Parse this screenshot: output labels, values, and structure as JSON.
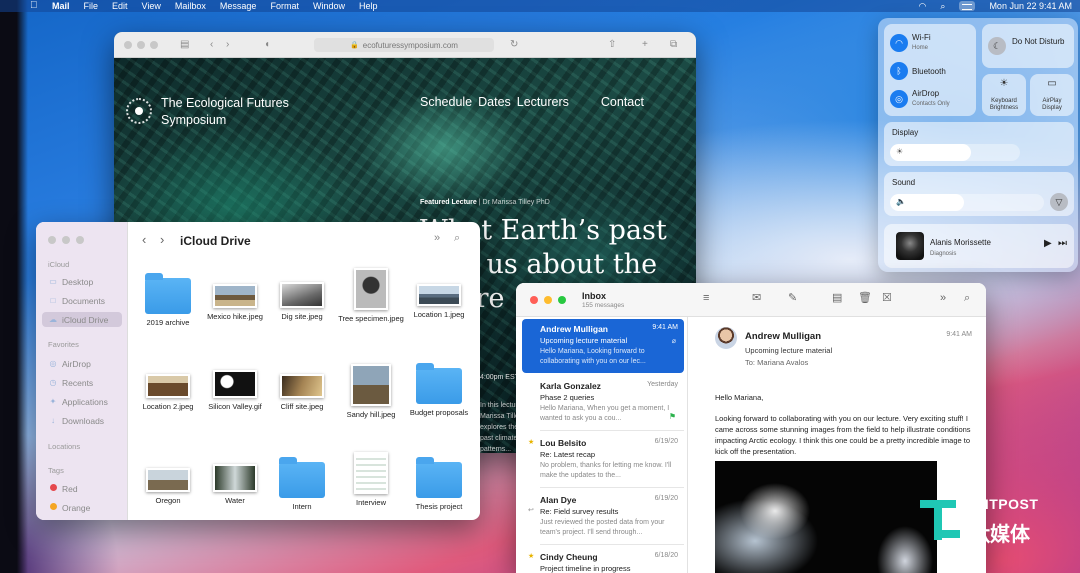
{
  "menubar": {
    "app_name": "Mail",
    "menus": [
      "File",
      "Edit",
      "View",
      "Mailbox",
      "Message",
      "Format",
      "Window",
      "Help"
    ],
    "clock": "Mon Jun 22  9:41 AM"
  },
  "safari": {
    "url": "ecofuturessymposium.com",
    "site": {
      "title": "The Ecological Futures Symposium",
      "nav": [
        "Schedule",
        "Dates",
        "Lecturers",
        "Contact"
      ],
      "featured_label": "Featured Lecture",
      "featured_speaker": "| Dr Marissa Tilley PhD",
      "headline": "What Earth’s past tells us about the future",
      "small_time": "4:00pm EST",
      "side_text": "In this lecture, Dr Marissa Tilley PhD explores the rise of past climate patterns..."
    }
  },
  "control_center": {
    "wifi": {
      "label": "Wi-Fi",
      "sub": "Home"
    },
    "bluetooth": {
      "label": "Bluetooth"
    },
    "airdrop": {
      "label": "AirDrop",
      "sub": "Contacts Only"
    },
    "dnd": {
      "label": "Do Not Disturb"
    },
    "keyboard": {
      "label": "Keyboard Brightness"
    },
    "airplay": {
      "label": "AirPlay Display"
    },
    "display": {
      "label": "Display",
      "level": 0.62
    },
    "sound": {
      "label": "Sound",
      "level": 0.48
    },
    "now_playing": {
      "artist": "Alanis Morissette",
      "track": "Diagnosis"
    }
  },
  "finder": {
    "title": "iCloud Drive",
    "sidebar": {
      "icloud_heading": "iCloud",
      "icloud_items": [
        "Desktop",
        "Documents",
        "iCloud Drive"
      ],
      "favorites_heading": "Favorites",
      "favorites_items": [
        "AirDrop",
        "Recents",
        "Applications",
        "Downloads"
      ],
      "locations_heading": "Locations",
      "tags_heading": "Tags",
      "tags": [
        {
          "label": "Red",
          "color": "#e5484d"
        },
        {
          "label": "Orange",
          "color": "#f5a623"
        }
      ]
    },
    "files": [
      "2019 archive",
      "Mexico hike.jpeg",
      "Dig site.jpeg",
      "Tree specimen.jpeg",
      "Location 1.jpeg",
      "Location 2.jpeg",
      "Silicon Valley.gif",
      "Cliff site.jpeg",
      "Sandy hill.jpeg",
      "Budget proposals",
      "Oregon",
      "Water",
      "Intern",
      "Interview",
      "Thesis project"
    ]
  },
  "mail": {
    "mailbox": "Inbox",
    "count": "155 messages",
    "messages": [
      {
        "from": "Andrew Mulligan",
        "date": "9:41 AM",
        "subject": "Upcoming lecture material",
        "preview": "Hello Mariana, Looking forward to collaborating with you on our lec..."
      },
      {
        "from": "Karla Gonzalez",
        "date": "Yesterday",
        "subject": "Phase 2 queries",
        "preview": "Hello Mariana, When you get a moment, I wanted to ask you a cou..."
      },
      {
        "from": "Lou Belsito",
        "date": "6/19/20",
        "subject": "Re: Latest recap",
        "preview": "No problem, thanks for letting me know. I'll make the updates to the..."
      },
      {
        "from": "Alan Dye",
        "date": "6/19/20",
        "subject": "Re: Field survey results",
        "preview": "Just reviewed the posted data from your team's project. I'll send through..."
      },
      {
        "from": "Cindy Cheung",
        "date": "6/18/20",
        "subject": "Project timeline in progress",
        "preview": ""
      }
    ],
    "reader": {
      "from": "Andrew Mulligan",
      "subject": "Upcoming lecture material",
      "to_label": "To:",
      "to": "Mariana Avalos",
      "time": "9:41 AM",
      "greeting": "Hello Mariana,",
      "body": "Looking forward to collaborating with you on our lecture. Very exciting stuff! I came across some stunning images from the field to help illustrate conditions impacting Arctic ecology. I think this one could be a pretty incredible image to kick off the presentation."
    }
  },
  "watermark": {
    "line1": "TMTPOST",
    "line2": "钛媒体",
    "color": "#1fc7b4"
  }
}
